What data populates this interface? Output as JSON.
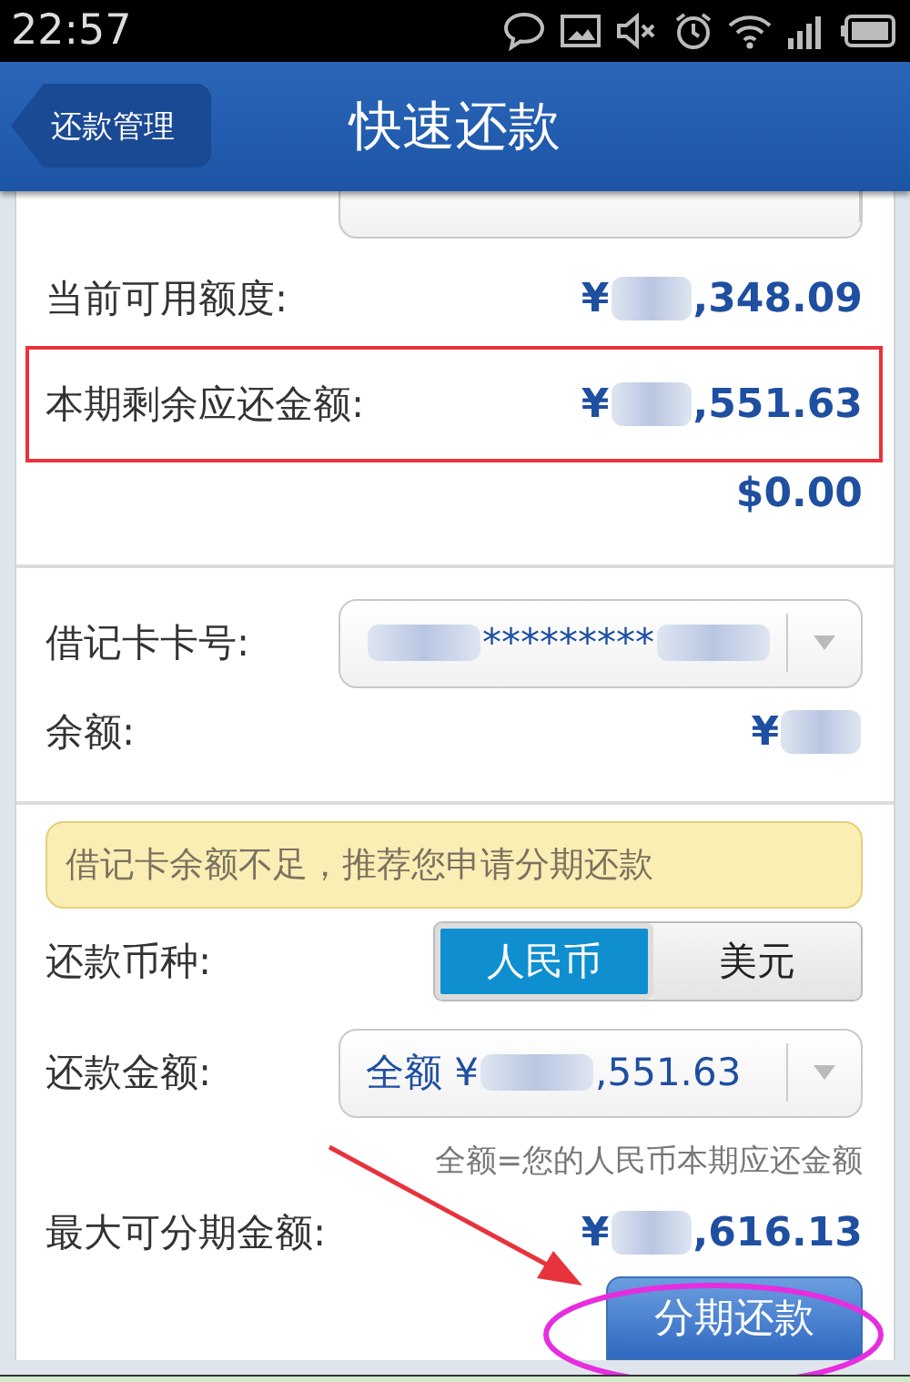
{
  "status_bar": {
    "time": "22:57"
  },
  "header": {
    "back": "还款管理",
    "title": "快速还款"
  },
  "sections": [
    {
      "rows": [
        {
          "kind": "select_partial"
        },
        {
          "kind": "amount",
          "label": "当前可用额度:",
          "value": [
            {
              "kind": "text",
              "text": "¥"
            },
            {
              "kind": "blur"
            },
            {
              "kind": "text",
              "text": ",348.09"
            }
          ]
        },
        {
          "kind": "amount",
          "label": "本期剩余应还金额:",
          "value": [
            {
              "kind": "text",
              "text": "¥"
            },
            {
              "kind": "blur"
            },
            {
              "kind": "text",
              "text": ",551.63"
            }
          ],
          "highlighted": true
        },
        {
          "kind": "note_amount",
          "value": [
            {
              "kind": "text",
              "text": "$0.00"
            }
          ]
        }
      ]
    },
    {
      "rows": [
        {
          "kind": "select",
          "label": "借记卡卡号:",
          "value": [
            {
              "kind": "blur"
            },
            {
              "kind": "text",
              "text": "*********"
            },
            {
              "kind": "blur"
            }
          ]
        },
        {
          "kind": "amount",
          "label": "余额:",
          "value": [
            {
              "kind": "text",
              "text": "¥"
            },
            {
              "kind": "blur"
            }
          ]
        }
      ]
    },
    {
      "rows": [
        {
          "kind": "warning",
          "text": "借记卡余额不足，推荐您申请分期还款"
        },
        {
          "kind": "segmented",
          "label": "还款币种:",
          "options": [
            {
              "label": "人民币",
              "selected": true
            },
            {
              "label": "美元",
              "selected": false
            }
          ]
        },
        {
          "kind": "select",
          "label": "还款金额:",
          "value": [
            {
              "kind": "text",
              "text": "全额 ¥"
            },
            {
              "kind": "blur"
            },
            {
              "kind": "text",
              "text": ",551.63"
            }
          ]
        },
        {
          "kind": "hint",
          "text": "全额=您的人民币本期应还金额"
        },
        {
          "kind": "amount",
          "label": "最大可分期金额:",
          "value": [
            {
              "kind": "text",
              "text": "¥"
            },
            {
              "kind": "blur"
            },
            {
              "kind": "text",
              "text": ",616.13"
            }
          ]
        },
        {
          "kind": "button",
          "text": "分期还款"
        }
      ]
    }
  ],
  "annotations": [
    {
      "kind": "arrow",
      "color": "#e8323c"
    },
    {
      "kind": "ellipse",
      "color": "#e62ee0"
    }
  ]
}
